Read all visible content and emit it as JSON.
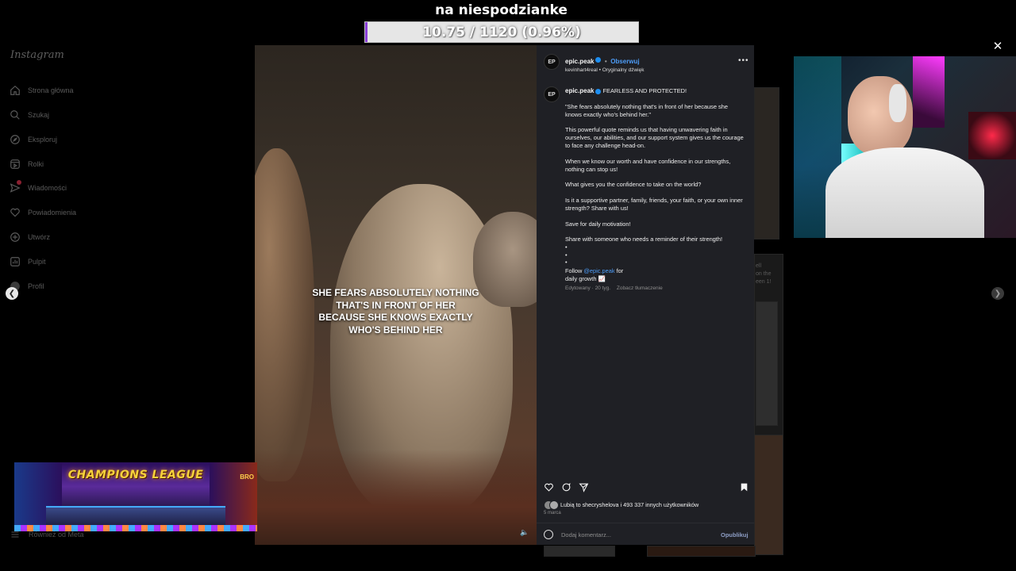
{
  "overlay": {
    "goal_title": "na niespodzianke",
    "goal_progress_text": "10.75 / 1120 (0.96%)",
    "goal_progress_fraction": 0.0096,
    "goal_fill_color": "#8a3fd8"
  },
  "sidebar": {
    "logo": "Instagram",
    "items": [
      {
        "label": "Strona główna",
        "icon": "home-icon"
      },
      {
        "label": "Szukaj",
        "icon": "search-icon"
      },
      {
        "label": "Eksploruj",
        "icon": "compass-icon"
      },
      {
        "label": "Rolki",
        "icon": "reels-icon"
      },
      {
        "label": "Wiadomości",
        "icon": "messenger-icon"
      },
      {
        "label": "Powiadomienia",
        "icon": "heart-icon"
      },
      {
        "label": "Utwórz",
        "icon": "plus-icon"
      },
      {
        "label": "Pulpit",
        "icon": "dashboard-icon"
      },
      {
        "label": "Profil",
        "icon": "avatar-icon"
      }
    ],
    "also_from_meta": "Również od Meta"
  },
  "video": {
    "caption_lines": [
      "SHE FEARS ABSOLUTELY NOTHING",
      "THAT'S IN FRONT OF HER",
      "BECAUSE SHE KNOWS EXACTLY",
      "WHO'S BEHIND HER"
    ]
  },
  "post": {
    "author": "epic.peak",
    "follow_label": "Obserwuj",
    "separator": "•",
    "audio_line": "kevinhart4real • Oryginalny dźwięk",
    "avatar_text": "EP",
    "caption_headline": "FEARLESS AND PROTECTED!",
    "paragraphs": [
      "\"She fears absolutely nothing that's in front of her because she knows exactly who's behind her.\"",
      "This powerful quote reminds us that having unwavering faith in ourselves, our abilities, and our support system gives us the courage to face any challenge head-on.",
      "When we know our worth and have confidence in our strengths, nothing can stop us!",
      "What gives you the confidence to take on the world?",
      "Is it a supportive partner, family, friends, your faith, or your own inner strength? Share with us!",
      "Save for daily motivation!",
      "Share with someone who needs a reminder of their strength!"
    ],
    "dots": [
      "•",
      "•",
      "•"
    ],
    "follow_prefix": "Follow ",
    "follow_mention": "@epic.peak",
    "follow_suffix": " for",
    "follow_line2": "daily growth 📈",
    "edited": "Edytowany · 20 tyg.",
    "see_translation": "Zobacz tłumaczenie",
    "likes_text": "Lubią to shecryshelova i 493 337 innych użytkowników",
    "date": "5 marca",
    "comment_placeholder": "Dodaj komentarz...",
    "publish_label": "Opublikuj"
  },
  "background": {
    "snippet_lines": [
      "ell",
      "on the",
      "een 1!"
    ]
  },
  "banner": {
    "title": "CHAMPIONS LEAGUE",
    "corner_text": "BRO"
  }
}
